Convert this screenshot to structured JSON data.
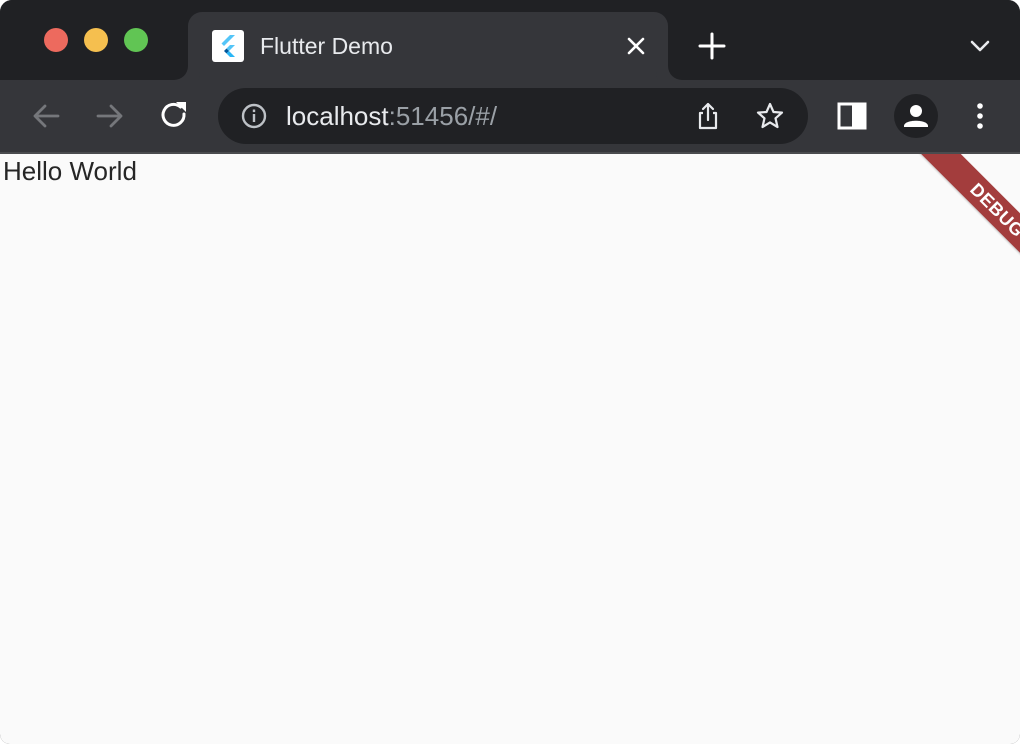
{
  "browser": {
    "tab": {
      "title": "Flutter Demo",
      "favicon": "flutter-logo-icon"
    },
    "toolbar": {
      "url_host": "localhost",
      "url_rest": ":51456/#/"
    },
    "icons": [
      "back-arrow-icon",
      "forward-arrow-icon",
      "reload-icon",
      "info-icon",
      "share-icon",
      "star-icon",
      "side-panel-icon",
      "profile-icon",
      "more-vert-icon",
      "close-icon",
      "plus-icon",
      "chevron-down-icon"
    ]
  },
  "page": {
    "text": "Hello World",
    "banner": "DEBUG"
  },
  "colors": {
    "traffic_red": "#ed6a5e",
    "traffic_yellow": "#f5bf4f",
    "traffic_green": "#61c554",
    "debug_banner": "#a33d3d",
    "page_background": "#fafafa"
  }
}
